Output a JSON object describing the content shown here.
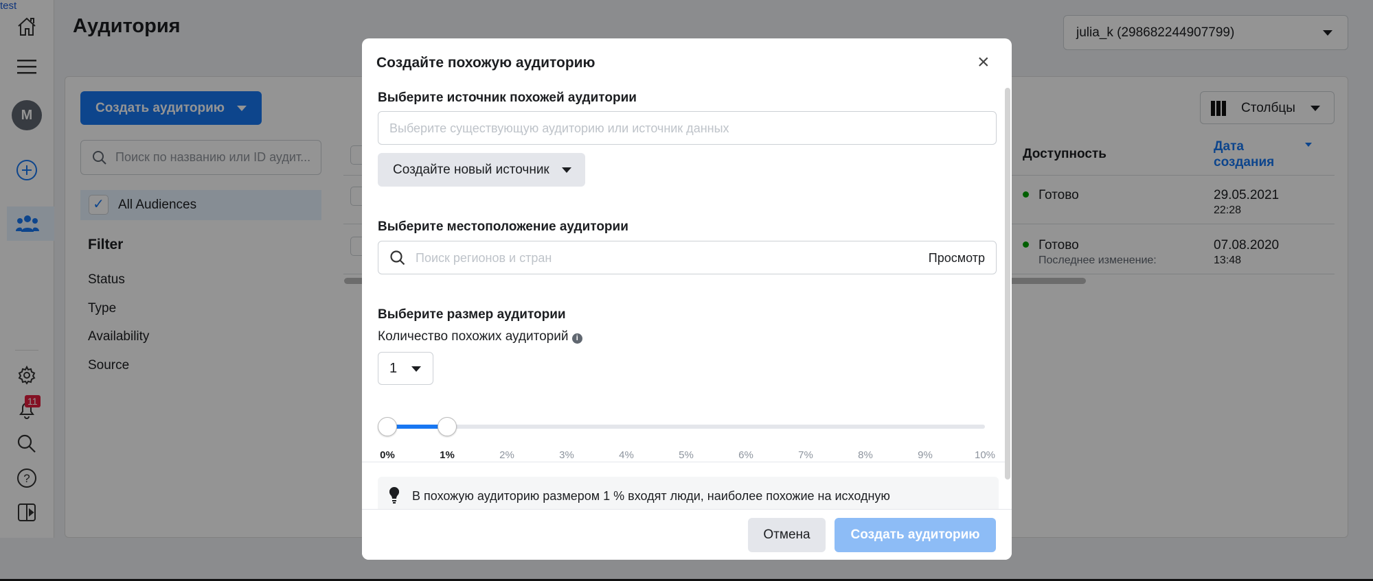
{
  "debug_label": "test",
  "page": {
    "title": "Аудитория",
    "account": "julia_k (298682244907799)",
    "create_button": "Создать аудиторию",
    "search_placeholder": "Поиск по названию или ID аудит...",
    "all_audiences": "All Audiences",
    "filter_title": "Filter",
    "filters": [
      "Status",
      "Type",
      "Availability",
      "Source"
    ],
    "columns_button": "Столбцы",
    "notifications_count": "11",
    "avatar_letter": "M"
  },
  "table": {
    "headers": {
      "availability": "Доступность",
      "created": "Дата создания"
    },
    "rows": [
      {
        "status": "Готово",
        "status_color": "#00a400",
        "date": "29.05.2021",
        "time": "22:28",
        "note": ""
      },
      {
        "status": "Готово",
        "status_color": "#00a400",
        "date": "07.08.2020",
        "time": "13:48",
        "note": "Последнее изменение:"
      }
    ]
  },
  "modal": {
    "title": "Создайте похожую аудиторию",
    "source_label": "Выберите источник похожей аудитории",
    "source_placeholder": "Выберите существующую аудиторию или источник данных",
    "new_source_button": "Создайте новый источник",
    "location_label": "Выберите местоположение аудитории",
    "location_placeholder": "Поиск регионов и стран",
    "browse": "Просмотр",
    "size_label": "Выберите размер аудитории",
    "count_label": "Количество похожих аудиторий",
    "count_value": "1",
    "slider": {
      "min": 0,
      "max": 10,
      "range": [
        0,
        1
      ],
      "ticks": [
        "0%",
        "1%",
        "2%",
        "3%",
        "4%",
        "5%",
        "6%",
        "7%",
        "8%",
        "9%",
        "10%"
      ]
    },
    "tip": "В похожую аудиторию размером 1 % входят люди, наиболее похожие на исходную",
    "cancel": "Отмена",
    "submit": "Создать аудиторию"
  },
  "colors": {
    "accent": "#1877f2",
    "submit_disabled": "#8dbcf6"
  }
}
